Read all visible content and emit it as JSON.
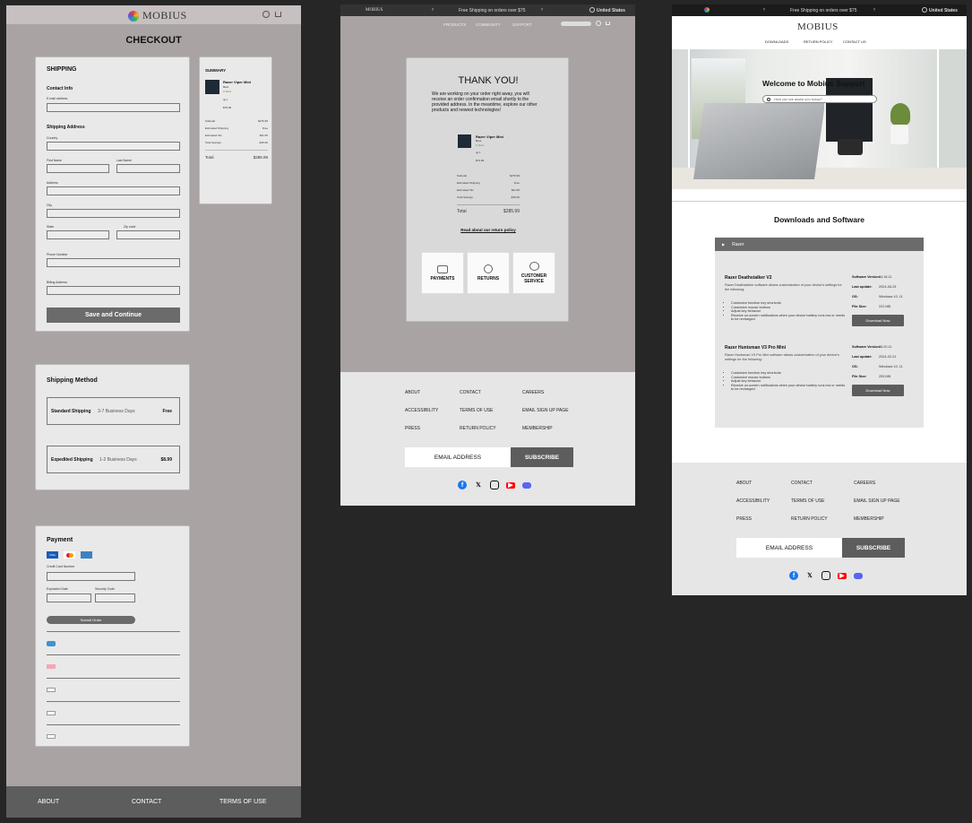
{
  "checkout": {
    "brand": "MOBIUS",
    "title": "CHECKOUT",
    "shipping": {
      "title": "SHIPPING",
      "contact_info": "Contact Info",
      "email_label": "E-mail address",
      "address_title": "Shipping Address",
      "country_label": "Country",
      "first_name_label": "First Name",
      "last_name_label": "Last Name",
      "address_label": "Address",
      "city_label": "City",
      "state_label": "State",
      "zip_label": "Zip code",
      "phone_label": "Phone Number",
      "billing_label": "Billing Address",
      "save_button": "Save and Continue"
    },
    "summary": {
      "title": "SUMMARY",
      "product_name": "Razer Viper Mini",
      "line1": "Black",
      "line2": "In Stock",
      "qty": "qty 1",
      "price": "$79.99",
      "rows": [
        {
          "label": "Subtotal",
          "value": "$279.99"
        },
        {
          "label": "Estimated Shipping",
          "value": "Free"
        },
        {
          "label": "Estimated Tax",
          "value": "$21.95"
        },
        {
          "label": "Total Savings",
          "value": "-$15.00"
        }
      ],
      "total_label": "Total",
      "total_value": "$285.99"
    },
    "method": {
      "title": "Shipping Method",
      "options": [
        {
          "name": "Standard Shipping",
          "days": "3-7 Business Days",
          "price": "Free"
        },
        {
          "name": "Expedited Shipping",
          "days": "1-2 Business Days",
          "price": "$8.99"
        }
      ]
    },
    "payment": {
      "title": "Payment",
      "cards": [
        "VISA",
        "MC",
        "AMEX"
      ],
      "cc_label": "Credit Card Number",
      "exp_label": "Expiration Date",
      "sec_label": "Security Code",
      "submit": "Submit Order",
      "alts": [
        "Venmo",
        "Klarna",
        "Apple Pay",
        "G Pay",
        "amazon"
      ]
    },
    "footer": [
      "ABOUT",
      "CONTACT",
      "TERMS OF USE"
    ]
  },
  "thankyou": {
    "banner": "Free Shipping on orders over $75",
    "brand": "MOBIUS",
    "region": "United States",
    "nav": [
      "PRODUCTS",
      "COMMUNITY",
      "SUPPORT"
    ],
    "title": "THANK YOU!",
    "message": "We are working on your order right away, you will receive an order confirmation email shortly to the provided address. In the meantime, explore our other products and newest technologies!",
    "product_name": "Razer Viper Mini",
    "line1": "Black",
    "line2": "In Stock",
    "qty": "qty 1",
    "price": "$79.99",
    "rows": [
      {
        "label": "Subtotal",
        "value": "$279.99"
      },
      {
        "label": "Estimated Shipping",
        "value": "Free"
      },
      {
        "label": "Estimated Tax",
        "value": "$21.95"
      },
      {
        "label": "Total Savings",
        "value": "-$15.00"
      }
    ],
    "total_label": "Total",
    "total_value": "$285.99",
    "return_link": "Read about our return policy",
    "tiles": [
      "PAYMENTS",
      "RETURNS",
      "CUSTOMER SERVICE"
    ],
    "footer": {
      "links": [
        "ABOUT",
        "CONTACT",
        "CAREERS",
        "ACCESSIBILITY",
        "TERMS OF USE",
        "EMAIL SIGN UP PAGE",
        "PRESS",
        "RETURN POLICY",
        "MEMBERSHIP"
      ],
      "email_placeholder": "EMAIL ADDRESS",
      "subscribe": "SUBSCRIBE"
    }
  },
  "support": {
    "banner": "Free Shipping on orders over $75",
    "brand": "MOBIUS",
    "region": "United States",
    "nav": [
      "DOWNLOADS",
      "RETURN POLICY",
      "CONTACT US"
    ],
    "hero_title": "Welcome to Mobius Support",
    "search_placeholder": "How can we assist you today?",
    "section_title": "Downloads and Software",
    "accordion": "Razer",
    "products": [
      {
        "name": "Razer Deathstalker V2",
        "desc": "Razer Deathstalker software allows customization of your device's settings for the following:",
        "bullets": [
          "Customize function key shortcuts",
          "Customize mouse buttons",
          "Adjust key behavior",
          "Receive on-screen notifications when your device battery runs low or needs to be recharged"
        ],
        "version_label": "Software Version:",
        "version": "04.18.11",
        "update_label": "Last update:",
        "update": "2024-06-23",
        "os_label": "OS:",
        "os": "Windows 10, 11",
        "size_label": "File Size:",
        "size": "222 MB",
        "download": "Download Now"
      },
      {
        "name": "Razer Huntsman V3 Pro Mini",
        "desc": "Razer Huntsman V3 Pro Mini software allows customization of your device's settings for the following:",
        "bullets": [
          "Customize function key shortcuts",
          "Customize mouse buttons",
          "Adjust key behavior",
          "Receive on-screen notifications when your device battery runs low or needs to be recharged"
        ],
        "version_label": "Software Version:",
        "version": "06.20.11",
        "update_label": "Last update:",
        "update": "2024-02-21",
        "os_label": "OS:",
        "os": "Windows 10, 11",
        "size_label": "File Size:",
        "size": "253 MB",
        "download": "Download Now"
      }
    ],
    "footer": {
      "links": [
        "ABOUT",
        "CONTACT",
        "CAREERS",
        "ACCESSIBILITY",
        "TERMS OF USE",
        "EMAIL SIGN UP PAGE",
        "PRESS",
        "RETURN POLICY",
        "MEMBERSHIP"
      ],
      "email_placeholder": "EMAIL ADDRESS",
      "subscribe": "SUBSCRIBE"
    }
  },
  "colors": {
    "canvas": "#262626",
    "checkout_bg": "#aaa3a3",
    "thankyou_bg": "#aaa3a3",
    "accent_button": "#6b6b6b",
    "footer_bg": "#e6e6e6"
  }
}
